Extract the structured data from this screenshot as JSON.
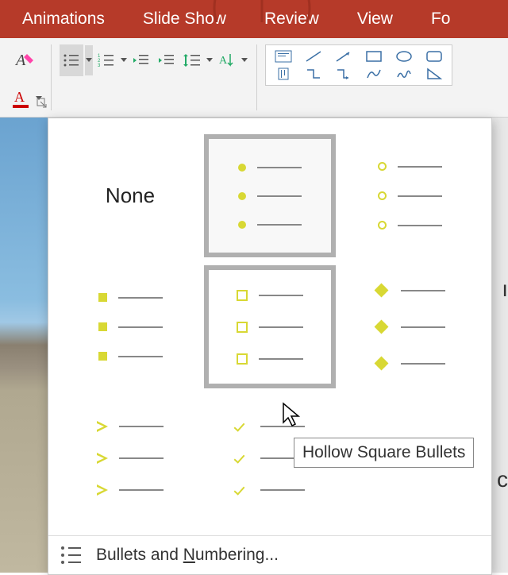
{
  "ribbon": {
    "tabs": [
      "Animations",
      "Slide Show",
      "Review",
      "View",
      "Fo"
    ]
  },
  "bullets": {
    "none_label": "None",
    "options": [
      {
        "name": "none"
      },
      {
        "name": "filled-round",
        "current": true
      },
      {
        "name": "hollow-round"
      },
      {
        "name": "filled-square"
      },
      {
        "name": "hollow-square",
        "hovering": true
      },
      {
        "name": "four-diamond"
      },
      {
        "name": "arrow"
      },
      {
        "name": "checkmark"
      }
    ],
    "tooltip": "Hollow Square Bullets",
    "footer": {
      "prefix": "Bullets and ",
      "mnemonic": "N",
      "suffix": "umbering..."
    }
  }
}
